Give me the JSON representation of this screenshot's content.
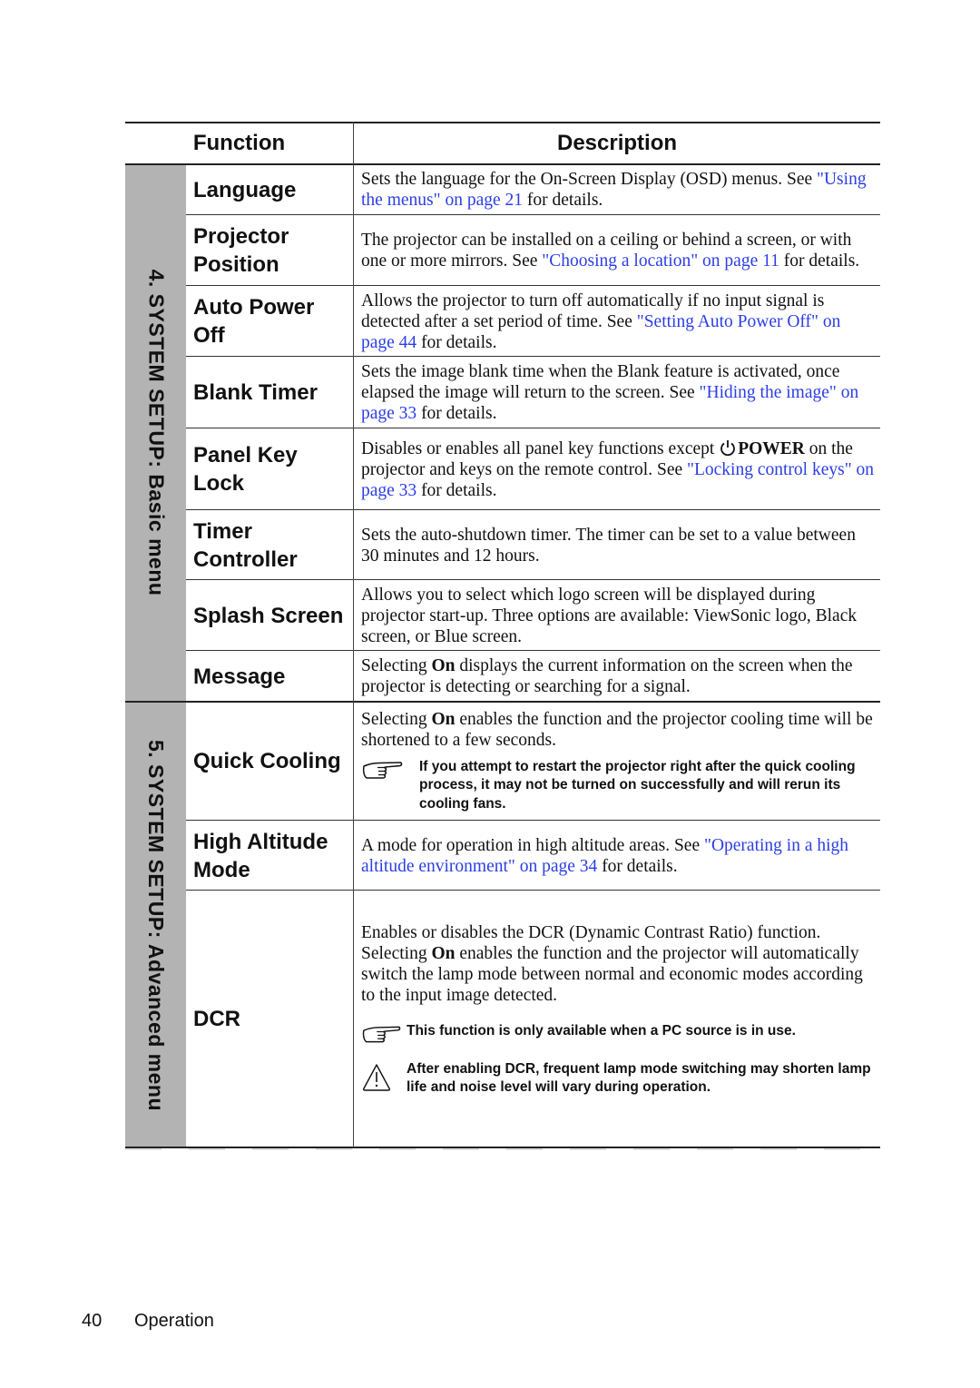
{
  "table": {
    "headers": {
      "function": "Function",
      "description": "Description"
    },
    "sections": [
      {
        "label": "4. SYSTEM SETUP: Basic menu"
      },
      {
        "label": "5. SYSTEM SETUP: Advanced menu"
      }
    ],
    "rows": [
      {
        "function": "Language",
        "desc": {
          "t1": "Sets the language for the On-Screen Display (OSD) menus. See ",
          "link": "\"Using the menus\" on page 21",
          "t2": " for details."
        }
      },
      {
        "function": "Projector Position",
        "desc": {
          "t1": "The projector can be installed on a ceiling or behind a screen, or with one or more mirrors. See ",
          "link": "\"Choosing a location\" on page 11",
          "t2": " for details."
        }
      },
      {
        "function": "Auto Power Off",
        "desc": {
          "t1": "Allows the projector to turn off automatically if no input signal is detected after a set period of time. See ",
          "link": "\"Setting Auto Power Off\" on page 44",
          "t2": " for details."
        }
      },
      {
        "function": "Blank Timer",
        "desc": {
          "t1": "Sets the image blank time when the Blank feature is activated, once elapsed the image will return to the screen. See ",
          "link": "\"Hiding the image\" on page 33",
          "t2": " for details."
        }
      },
      {
        "function": "Panel Key Lock",
        "desc": {
          "t1": "Disables or enables all panel key functions except ",
          "power": "POWER",
          "t1b": " on the projector and keys on the remote control. See ",
          "link": "\"Locking control keys\" on page 33",
          "t2": " for details."
        }
      },
      {
        "function": "Timer Controller",
        "desc": {
          "t1": "Sets the auto-shutdown timer. The timer can be set to a value between 30 minutes and 12 hours."
        }
      },
      {
        "function": "Splash Screen",
        "desc": {
          "t1": "Allows you to select which logo screen will be displayed during projector start-up. Three options are available: ViewSonic logo, Black screen, or Blue screen."
        }
      },
      {
        "function": "Message",
        "desc": {
          "t1": "Selecting ",
          "bold": "On",
          "t2": " displays the current information on the screen when the projector is detecting or searching for a signal."
        }
      },
      {
        "function": "Quick Cooling",
        "desc": {
          "t1": "Selecting ",
          "bold": "On",
          "t2": " enables the function and the projector cooling time will be shortened to a few seconds.",
          "note": "If you attempt to restart the projector right after the quick cooling process, it may not be turned on successfully and will rerun its cooling fans."
        }
      },
      {
        "function": "High Altitude Mode",
        "desc": {
          "t1": "A mode for operation in high altitude areas. See ",
          "link": "\"Operating in a high altitude environment\" on page 34",
          "t2": " for details."
        }
      },
      {
        "function": "DCR",
        "desc": {
          "t1": "Enables or disables the DCR (Dynamic Contrast Ratio) function. Selecting ",
          "bold": "On",
          "t2": " enables the function and the projector will automatically switch the lamp mode between normal and economic modes according to the input image detected.",
          "note": "This function is only available when a PC source is in use.",
          "warning": "After enabling DCR, frequent lamp mode switching may shorten lamp life and noise level will vary during operation."
        }
      }
    ]
  },
  "footer": {
    "page_number": "40",
    "section": "Operation"
  },
  "colors": {
    "link": "#2b3ee6",
    "section_band": "#b3b3b3",
    "text": "#111111"
  },
  "icons": {
    "note": "pointing-hand-icon",
    "warning": "warning-triangle-icon",
    "power": "power-icon"
  }
}
